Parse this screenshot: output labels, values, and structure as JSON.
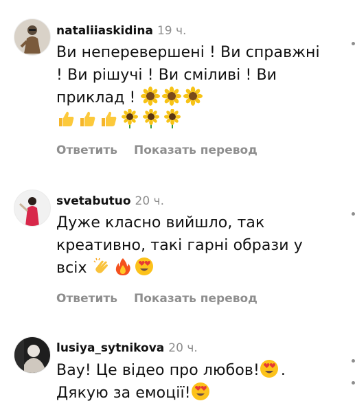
{
  "comments": [
    {
      "username": "nataliiaskidina",
      "time": "19 ч.",
      "text": "Ви неперевершені ! Ви справжні ! Ви рішучі ! Ви сміливі ! Ви приклад !",
      "emojis_line1": [
        "sunflower",
        "sunflower",
        "sunflower"
      ],
      "emojis_line2": [
        "thumbs-up",
        "thumbs-up",
        "thumbs-up",
        "sunflower",
        "sunflower",
        "sunflower"
      ],
      "reply": "Ответить",
      "translate": "Показать перевод"
    },
    {
      "username": "svetabutuo",
      "time": "20 ч.",
      "text": "Дуже класно вийшло, так креативно, такі гарні образи у всіх",
      "emojis": [
        "clapping-hands",
        "fire",
        "heart-eyes"
      ],
      "reply": "Ответить",
      "translate": "Показать перевод"
    },
    {
      "username": "lusiya_sytnikova",
      "time": "20 ч.",
      "text_part1": "Вау! Це відео про любов!",
      "text_part2": ".",
      "text_part3": "Дякую за емоції!",
      "emojis": [
        "heart-eyes",
        "heart-eyes"
      ]
    }
  ],
  "colors": {
    "username": "#111111",
    "secondary": "#8e8e8e",
    "background": "#ffffff"
  }
}
